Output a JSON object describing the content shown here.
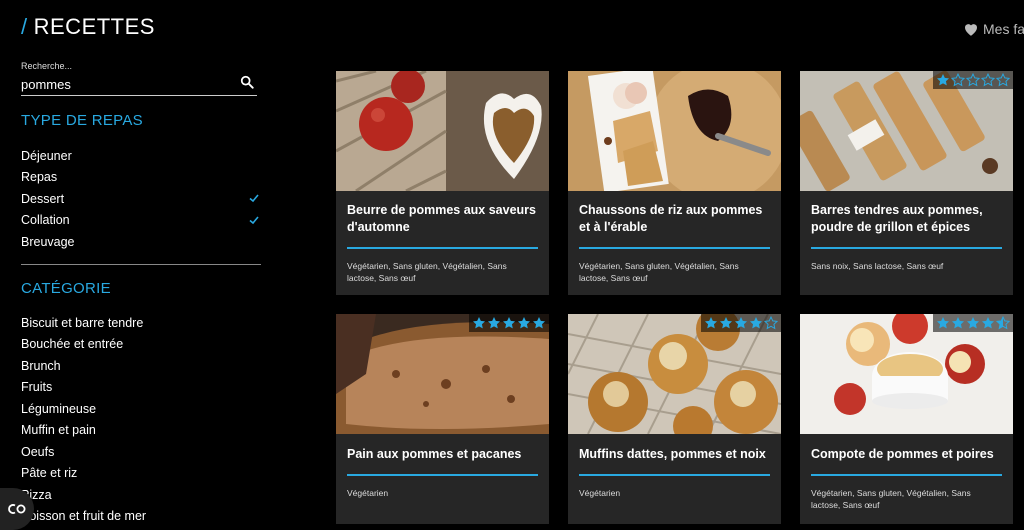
{
  "header": {
    "slash": "/",
    "title": "RECETTES",
    "favorites_label": "Mes fav"
  },
  "search": {
    "label": "Recherche...",
    "value": "pommes"
  },
  "meal_type": {
    "title": "TYPE DE REPAS",
    "items": [
      {
        "label": "Déjeuner",
        "checked": false
      },
      {
        "label": "Repas",
        "checked": false
      },
      {
        "label": "Dessert",
        "checked": true
      },
      {
        "label": "Collation",
        "checked": true
      },
      {
        "label": "Breuvage",
        "checked": false
      }
    ]
  },
  "category": {
    "title": "CATÉGORIE",
    "items": [
      {
        "label": "Biscuit et barre tendre"
      },
      {
        "label": "Bouchée et entrée"
      },
      {
        "label": "Brunch"
      },
      {
        "label": "Fruits"
      },
      {
        "label": "Légumineuse"
      },
      {
        "label": "Muffin et pain"
      },
      {
        "label": "Oeufs"
      },
      {
        "label": "Pâte et riz"
      },
      {
        "label": "Pizza"
      },
      {
        "label": "Poisson et fruit de mer"
      }
    ]
  },
  "recipes": [
    {
      "name": "Beurre de pommes aux saveurs d'automne",
      "tags": "Végétarien, Sans gluten, Végétalien, Sans lactose, Sans œuf",
      "rating": null,
      "image": "apple-butter-photo"
    },
    {
      "name": "Chaussons de riz aux pommes et à l'érable",
      "tags": "Végétarien, Sans gluten, Végétalien, Sans lactose, Sans œuf",
      "rating": null,
      "image": "apple-turnovers-photo"
    },
    {
      "name": "Barres tendres aux pommes, poudre de grillon et épices",
      "tags": "Sans noix, Sans lactose, Sans œuf",
      "rating": 1,
      "image": "apple-bars-photo"
    },
    {
      "name": "Pain aux pommes et pacanes",
      "tags": "Végétarien",
      "rating": 5,
      "image": "apple-bread-photo"
    },
    {
      "name": "Muffins dattes, pommes et noix",
      "tags": "Végétarien",
      "rating": 4,
      "image": "muffins-photo"
    },
    {
      "name": "Compote de pommes et poires",
      "tags": "Végétarien, Sans gluten, Végétalien, Sans lactose, Sans œuf",
      "rating": 4.5,
      "image": "compote-photo"
    }
  ],
  "colors": {
    "accent": "#29a9e1",
    "card_bg": "#262626",
    "star": "#29a9e1"
  },
  "cookie_button": {
    "icon": "cookie-settings-icon"
  }
}
